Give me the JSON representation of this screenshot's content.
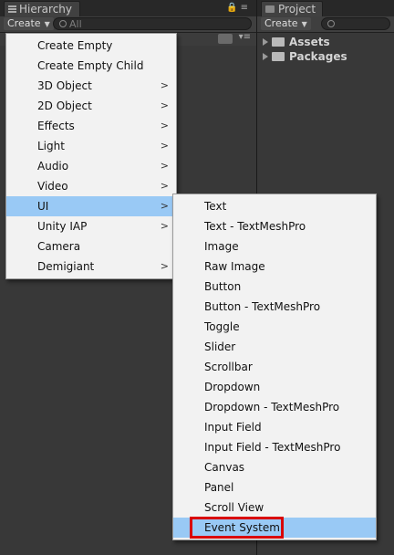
{
  "hierarchy": {
    "tab_title": "Hierarchy",
    "create_label": "Create",
    "search_placeholder": "All"
  },
  "project": {
    "tab_title": "Project",
    "create_label": "Create",
    "tree": [
      "Assets",
      "Packages"
    ]
  },
  "create_menu": {
    "items": [
      {
        "label": "Create Empty",
        "submenu": false
      },
      {
        "label": "Create Empty Child",
        "submenu": false
      },
      {
        "label": "3D Object",
        "submenu": true
      },
      {
        "label": "2D Object",
        "submenu": true
      },
      {
        "label": "Effects",
        "submenu": true
      },
      {
        "label": "Light",
        "submenu": true
      },
      {
        "label": "Audio",
        "submenu": true
      },
      {
        "label": "Video",
        "submenu": true
      },
      {
        "label": "UI",
        "submenu": true,
        "highlighted": true
      },
      {
        "label": "Unity IAP",
        "submenu": true
      },
      {
        "label": "Camera",
        "submenu": false
      },
      {
        "label": "Demigiant",
        "submenu": true
      }
    ]
  },
  "ui_submenu": {
    "items": [
      "Text",
      "Text - TextMeshPro",
      "Image",
      "Raw Image",
      "Button",
      "Button - TextMeshPro",
      "Toggle",
      "Slider",
      "Scrollbar",
      "Dropdown",
      "Dropdown - TextMeshPro",
      "Input Field",
      "Input Field - TextMeshPro",
      "Canvas",
      "Panel",
      "Scroll View",
      "Event System"
    ],
    "highlighted": "Event System"
  },
  "colors": {
    "highlight": "#99c9f5",
    "callout": "#d90000",
    "menu_bg": "#f2f2f2",
    "panel_bg": "#383838"
  }
}
